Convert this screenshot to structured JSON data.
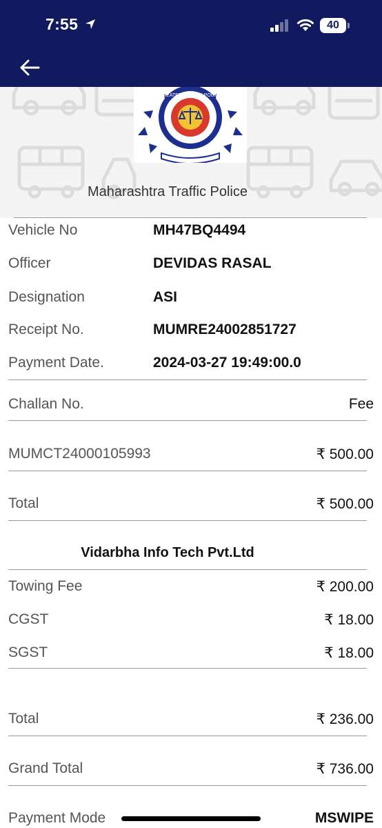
{
  "status_bar": {
    "time": "7:55",
    "battery": "40"
  },
  "header": {
    "back_icon": "arrow-left-icon"
  },
  "banner": {
    "title": "Maharashtra Traffic Police",
    "logo_name": "greater-mumbai-police-emblem",
    "logo_text": "GREATER MUMBAI POLICE"
  },
  "details": [
    {
      "label": "Vehicle No",
      "value": "MH47BQ4494"
    },
    {
      "label": "Officer",
      "value": "DEVIDAS RASAL"
    },
    {
      "label": "Designation",
      "value": "ASI"
    },
    {
      "label": "Receipt No.",
      "value": "MUMRE24002851727"
    },
    {
      "label": "Payment Date.",
      "value": "2024-03-27 19:49:00.0"
    }
  ],
  "challan": {
    "header_left": "Challan No.",
    "header_right": "Fee",
    "number": "MUMCT24000105993",
    "fee": "₹ 500.00",
    "total_label": "Total",
    "total_value": "₹ 500.00"
  },
  "towing": {
    "company": "Vidarbha Info Tech Pvt.Ltd",
    "items": [
      {
        "label": "Towing Fee",
        "value": "₹ 200.00"
      },
      {
        "label": "CGST",
        "value": "₹ 18.00"
      },
      {
        "label": "SGST",
        "value": "₹ 18.00"
      }
    ],
    "total_label": "Total",
    "total_value": "₹ 236.00"
  },
  "grand_total": {
    "label": "Grand Total",
    "value": "₹ 736.00"
  },
  "payment_mode": {
    "label": "Payment Mode",
    "value": "MSWIPE"
  },
  "colors": {
    "header_bg": "#111a5e",
    "banner_bg": "#f4f4f4"
  }
}
